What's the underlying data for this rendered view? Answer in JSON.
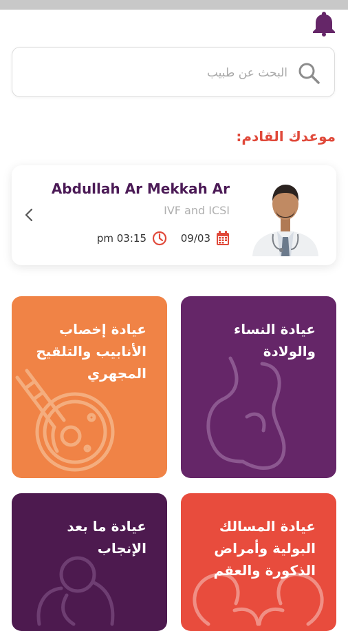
{
  "search": {
    "placeholder": "البحث عن طبيب"
  },
  "upcoming": {
    "title": "موعدك القادم:"
  },
  "appointment": {
    "doctor_name": "Abdullah Ar Mekkah Ar",
    "specialty": "IVF and ICSI",
    "date": "09/03",
    "time": "pm 03:15"
  },
  "clinics": [
    {
      "label": "عيادة النساء والولادة"
    },
    {
      "label": "عيادة إخصاب الأنابيب والتلقيح المجهري"
    },
    {
      "label": "عيادة المسالك البولية وأمراض الذكورة والعقم"
    },
    {
      "label": "عيادة ما بعد الإنجاب"
    }
  ],
  "colors": {
    "brand_purple": "#652668",
    "accent_red": "#e0493a",
    "orange": "#f08346",
    "coral": "#e84c3d",
    "dark_purple": "#4d1a4f"
  }
}
